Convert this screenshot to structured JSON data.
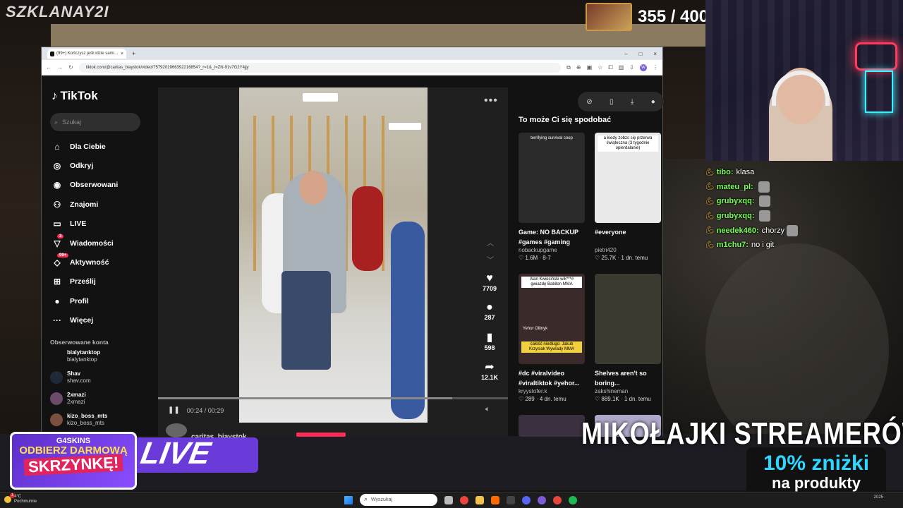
{
  "stream": {
    "channel": "SZKLANAY2I",
    "goal_count": "355 / 400",
    "overlay_banner": "MIKOŁAJKI STREAMERÓW",
    "discount_top": "10% zniżki",
    "discount_bottom": "na produkty",
    "promo_brand": "G4SKINS",
    "promo_line1": "ODBIERZ DARMOWĄ",
    "promo_line2": "SKRZYNKĘ!",
    "live_text": "LIVE",
    "chat": [
      {
        "user": "tibo:",
        "text": "klasa",
        "emote": false
      },
      {
        "user": "mateu_pl:",
        "text": "",
        "emote": true
      },
      {
        "user": "grubyxqq:",
        "text": "",
        "emote": true
      },
      {
        "user": "grubyxqq:",
        "text": "",
        "emote": true
      },
      {
        "user": "needek460:",
        "text": "chorzy",
        "emote": true
      },
      {
        "user": "m1chu7:",
        "text": "no i git",
        "emote": false
      }
    ]
  },
  "browser": {
    "tab_title": "(99+) Kończysz jeśli idzie sami…",
    "url": "tiktok.com/@caritas_biaystok/video/7579201966392216854?_r=1&_t=ZN-91v7G2Y4jjy",
    "profile_initial": "W"
  },
  "tiktok": {
    "logo": "TikTok",
    "search_placeholder": "Szukaj",
    "menu": [
      {
        "label": "Dla Ciebie",
        "icon": "home-icon",
        "glyph": "⌂",
        "badge": ""
      },
      {
        "label": "Odkryj",
        "icon": "compass-icon",
        "glyph": "◎",
        "badge": ""
      },
      {
        "label": "Obserwowani",
        "icon": "following-icon",
        "glyph": "◉",
        "badge": ""
      },
      {
        "label": "Znajomi",
        "icon": "friends-icon",
        "glyph": "⚇",
        "badge": ""
      },
      {
        "label": "LIVE",
        "icon": "live-icon",
        "glyph": "▭",
        "badge": ""
      },
      {
        "label": "Wiadomości",
        "icon": "messages-icon",
        "glyph": "▽",
        "badge": "3"
      },
      {
        "label": "Aktywność",
        "icon": "activity-icon",
        "glyph": "◇",
        "badge": "99+"
      },
      {
        "label": "Prześlij",
        "icon": "upload-icon",
        "glyph": "⊞",
        "badge": ""
      },
      {
        "label": "Profil",
        "icon": "profile-icon",
        "glyph": "●",
        "badge": ""
      },
      {
        "label": "Więcej",
        "icon": "more-icon",
        "glyph": "···",
        "badge": ""
      }
    ],
    "followed_title": "Obserwowane konta",
    "followed": [
      {
        "name": "bialytanktop",
        "handle": "bialytanktop"
      },
      {
        "name": "Shav",
        "handle": "shav.com"
      },
      {
        "name": "2xmazi",
        "handle": "2xmazi"
      },
      {
        "name": "kizo_boss_mts",
        "handle": "kizo_boss_mts"
      }
    ],
    "player": {
      "time": "00:24 / 00:29",
      "progress": 0.84,
      "likes": "7709",
      "comments": "287",
      "saves": "598",
      "shares": "12.1K",
      "author": "caritas_biaystok"
    },
    "rail_title": "To może Ci się spodobać",
    "recommendations": [
      {
        "caption": "terrifying survival coop",
        "title": "Game: NO BACKUP #games #gaming",
        "author": "nobackupgame",
        "meta": "♡ 1.6M · 8-7",
        "bg": "#2b2b2b"
      },
      {
        "caption": "a kiedy zobzs się przerwa świąteczna (3 tygodnie opierdalanie)",
        "title": "#everyone",
        "author": "pietri420",
        "meta": "♡ 25.7K · 1 dn. temu",
        "bg": "#e9e9e9"
      },
      {
        "caption": "Alan Kwieciński wik***# gwiazdę Babilon MMA",
        "title": "#dc #viralvideo #viraltiktok #yehor...",
        "author": "kryystofer.k",
        "meta": "♡ 289 · 4 dn. temu",
        "bg": "#3a2a2a"
      },
      {
        "caption": "",
        "title": "Shelves aren't so boring...",
        "author": "zakshineman",
        "meta": "♡ 889.1K · 1 dn. temu",
        "bg": "#3b3a30"
      }
    ],
    "rec_extra_captions": [
      "Yehor Oliinyk",
      "całość niedługo: Jakub Krzysiak Wywiady MMA"
    ]
  },
  "taskbar": {
    "weather_temp": "4°C",
    "weather_desc": "Pochmurnie",
    "weather_badge": "1",
    "search_placeholder": "Wyszukaj",
    "clock_time": "",
    "clock_date": "2025"
  }
}
